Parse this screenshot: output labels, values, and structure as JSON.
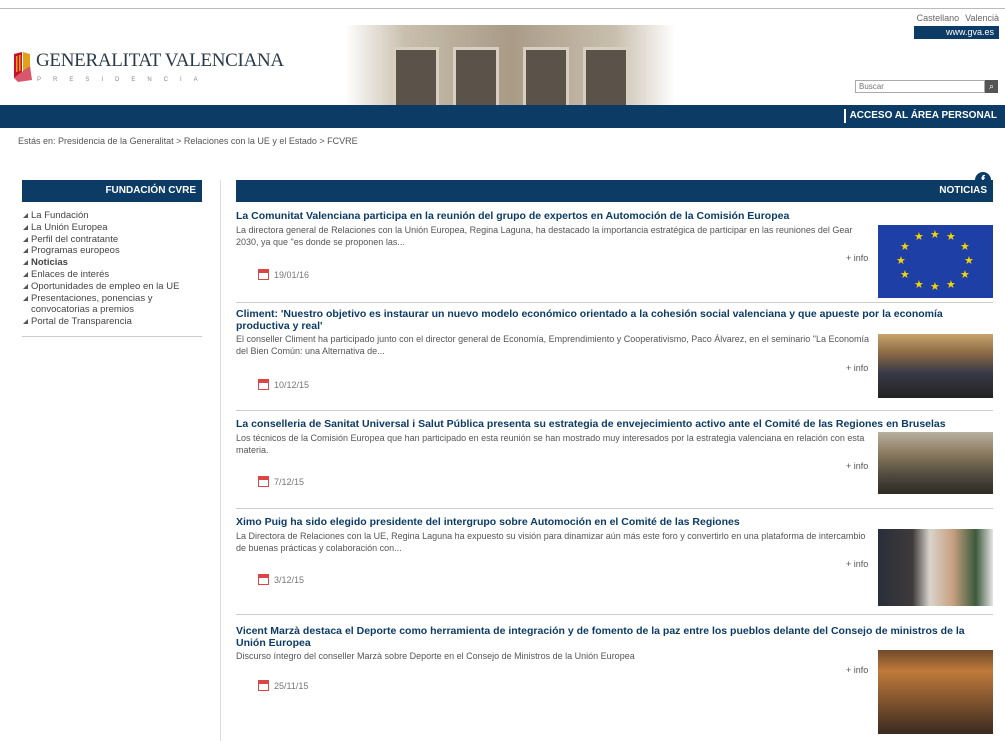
{
  "header": {
    "lang_castellano": "Castellano",
    "lang_valencia": "Valencià",
    "gva_link": "www.gva.es",
    "logo_text": "GENERALITAT VALENCIANA",
    "logo_sub": "PRESIDENCIA",
    "search_placeholder": "Buscar",
    "search_icon": "search-icon",
    "area_personal": "ACCESO AL ÁREA PERSONAL",
    "brand_color": "#0c3b66"
  },
  "breadcrumb": "Estás en: Presidencia de la Generalitat > Relaciones con la UE y el Estado > FCVRE",
  "sidebar": {
    "title": "FUNDACIÓN CVRE",
    "items": [
      {
        "label": "La Fundación"
      },
      {
        "label": "La Unión Europea"
      },
      {
        "label": "Perfil del contratante"
      },
      {
        "label": "Programas europeos"
      },
      {
        "label": "Noticias"
      },
      {
        "label": "Enlaces de interés"
      },
      {
        "label": "Oportunidades de empleo en la UE"
      },
      {
        "label": "Presentaciones, ponencias y convocatorias a premios"
      },
      {
        "label": "Portal de Transparencia"
      }
    ]
  },
  "main": {
    "title": "NOTICIAS",
    "more_label": "+ info",
    "news": [
      {
        "title": "La Comunitat Valenciana participa en la reunión del grupo de expertos en Automoción de la Comisión Europea",
        "summary": "La directora general de Relaciones con la Unión Europea, Regina Laguna, ha destacado la importancia estratégica de participar en las reuniones del Gear 2030, ya que \"es donde se proponen las...",
        "date": "19/01/16"
      },
      {
        "title": "Climent: 'Nuestro objetivo es instaurar un nuevo modelo económico orientado a la cohesión social valenciana y que apueste por la economía productiva y real'",
        "summary": "El conseller Climent ha participado junto con el director general de Economía, Emprendimiento y Cooperativismo, Paco Álvarez, en el seminario \"La Economía del Bien Común: una Alternativa de...",
        "date": "10/12/15"
      },
      {
        "title": "La conselleria de Sanitat Universal i Salut Pública presenta su estrategia de envejecimiento activo ante el Comité de las Regiones en Bruselas",
        "summary": "Los técnicos de la Comisión Europea que han participado en esta reunión se han mostrado muy interesados por la estrategia valenciana en relación con esta materia.",
        "date": "7/12/15"
      },
      {
        "title": "Ximo Puig ha sido elegido presidente del intergrupo sobre Automoción en el Comité de las Regiones",
        "summary": "La Directora de Relaciones con la UE, Regina Laguna ha expuesto su visión para dinamizar aún más este foro y convertirlo en una plataforma de intercambio de buenas prácticas y colaboración con...",
        "date": "3/12/15"
      },
      {
        "title": "Vicent Marzà destaca el Deporte como herramienta de integración y de fomento de la paz entre los pueblos delante del Consejo de ministros de la Unión Europea",
        "summary": "Discurso íntegro del conseller Marzà sobre Deporte en el Consejo de Ministros de la Unión Europea",
        "date": "25/11/15"
      }
    ]
  }
}
